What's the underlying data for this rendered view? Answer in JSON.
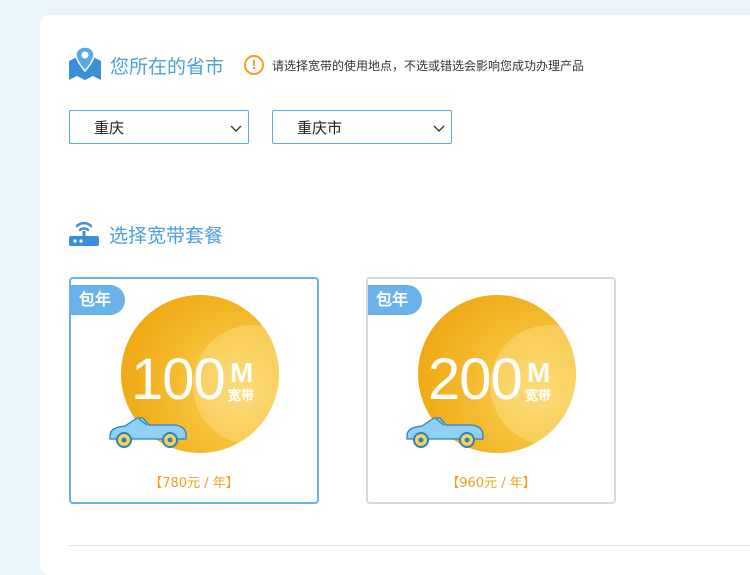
{
  "location": {
    "title": "您所在的省市",
    "warning": "请选择宽带的使用地点，不选或错选会影响您成功办理产品",
    "province": "重庆",
    "city": "重庆市"
  },
  "plans_section": {
    "title": "选择宽带套餐",
    "plans": [
      {
        "badge": "包年",
        "speed": "100",
        "unit": "M",
        "unit_label": "宽带",
        "price": "【780元 / 年】",
        "selected": true
      },
      {
        "badge": "包年",
        "speed": "200",
        "unit": "M",
        "unit_label": "宽带",
        "price": "【960元 / 年】",
        "selected": false
      }
    ]
  },
  "colors": {
    "accent": "#4a9fe0",
    "gold": "#f0a020",
    "badge": "#6ab2ea"
  },
  "icons": [
    "map-pin-icon",
    "warning-icon",
    "chevron-down-icon",
    "router-icon",
    "car-icon"
  ]
}
